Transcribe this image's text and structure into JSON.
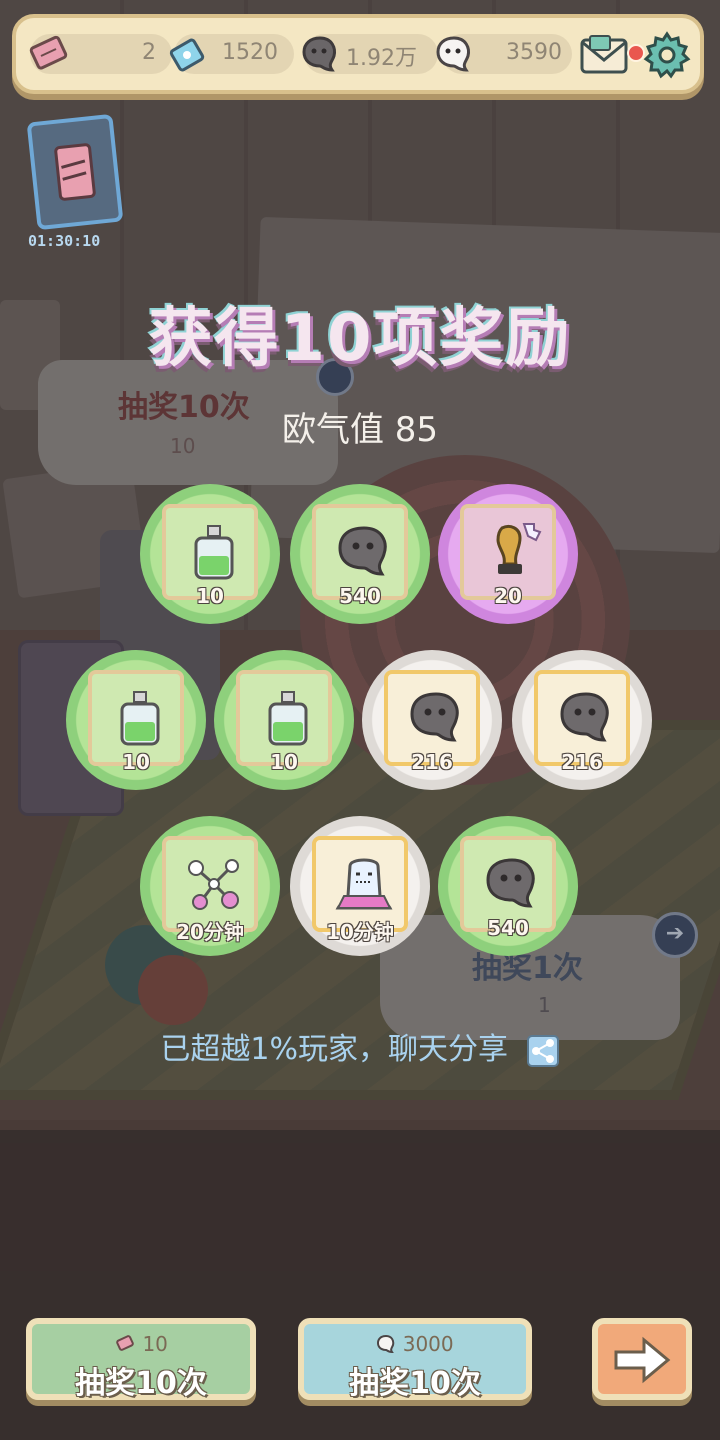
{
  "currency_bar": {
    "tickets": "2",
    "crystals": "1520",
    "dark_souls": "1.92万",
    "light_souls": "3590",
    "icons": [
      "ticket-icon",
      "crystal-icon",
      "dark-soul-icon",
      "ghost-soul-icon",
      "mail-icon",
      "gear-icon"
    ]
  },
  "event": {
    "timer": "01:30:10"
  },
  "background_signs": {
    "left": {
      "label": "抽奖10次",
      "cost": "10"
    },
    "right": {
      "label": "抽奖1次",
      "cost": "1"
    }
  },
  "title": "获得10项奖励",
  "luck": {
    "label": "欧气值",
    "value": "85"
  },
  "rewards": [
    {
      "item": "potion-bottle",
      "count": "10",
      "rarity": "green"
    },
    {
      "item": "dark-soul",
      "count": "540",
      "rarity": "green"
    },
    {
      "item": "golden-trophy-fragment",
      "count": "20",
      "rarity": "purple"
    },
    {
      "item": "potion-bottle",
      "count": "10",
      "rarity": "green"
    },
    {
      "item": "potion-bottle",
      "count": "10",
      "rarity": "green"
    },
    {
      "item": "dark-soul",
      "count": "216",
      "rarity": "white"
    },
    {
      "item": "dark-soul",
      "count": "216",
      "rarity": "white"
    },
    {
      "item": "molecule-booster",
      "count": "20分钟",
      "rarity": "green"
    },
    {
      "item": "ghost-booster",
      "count": "10分钟",
      "rarity": "white"
    },
    {
      "item": "dark-soul",
      "count": "540",
      "rarity": "green"
    }
  ],
  "share_text": "已超越1%玩家，聊天分享",
  "buttons": {
    "draw10_ticket": {
      "cost": "10",
      "label": "抽奖10次"
    },
    "draw10_soul": {
      "cost": "3000",
      "label": "抽奖10次"
    },
    "next": {
      "icon": "arrow-right-icon"
    }
  },
  "colors": {
    "green_tier": "#8ed07c",
    "purple_tier": "#cf86de",
    "white_tier": "#dedad6",
    "title_glow": "#b57db5"
  }
}
